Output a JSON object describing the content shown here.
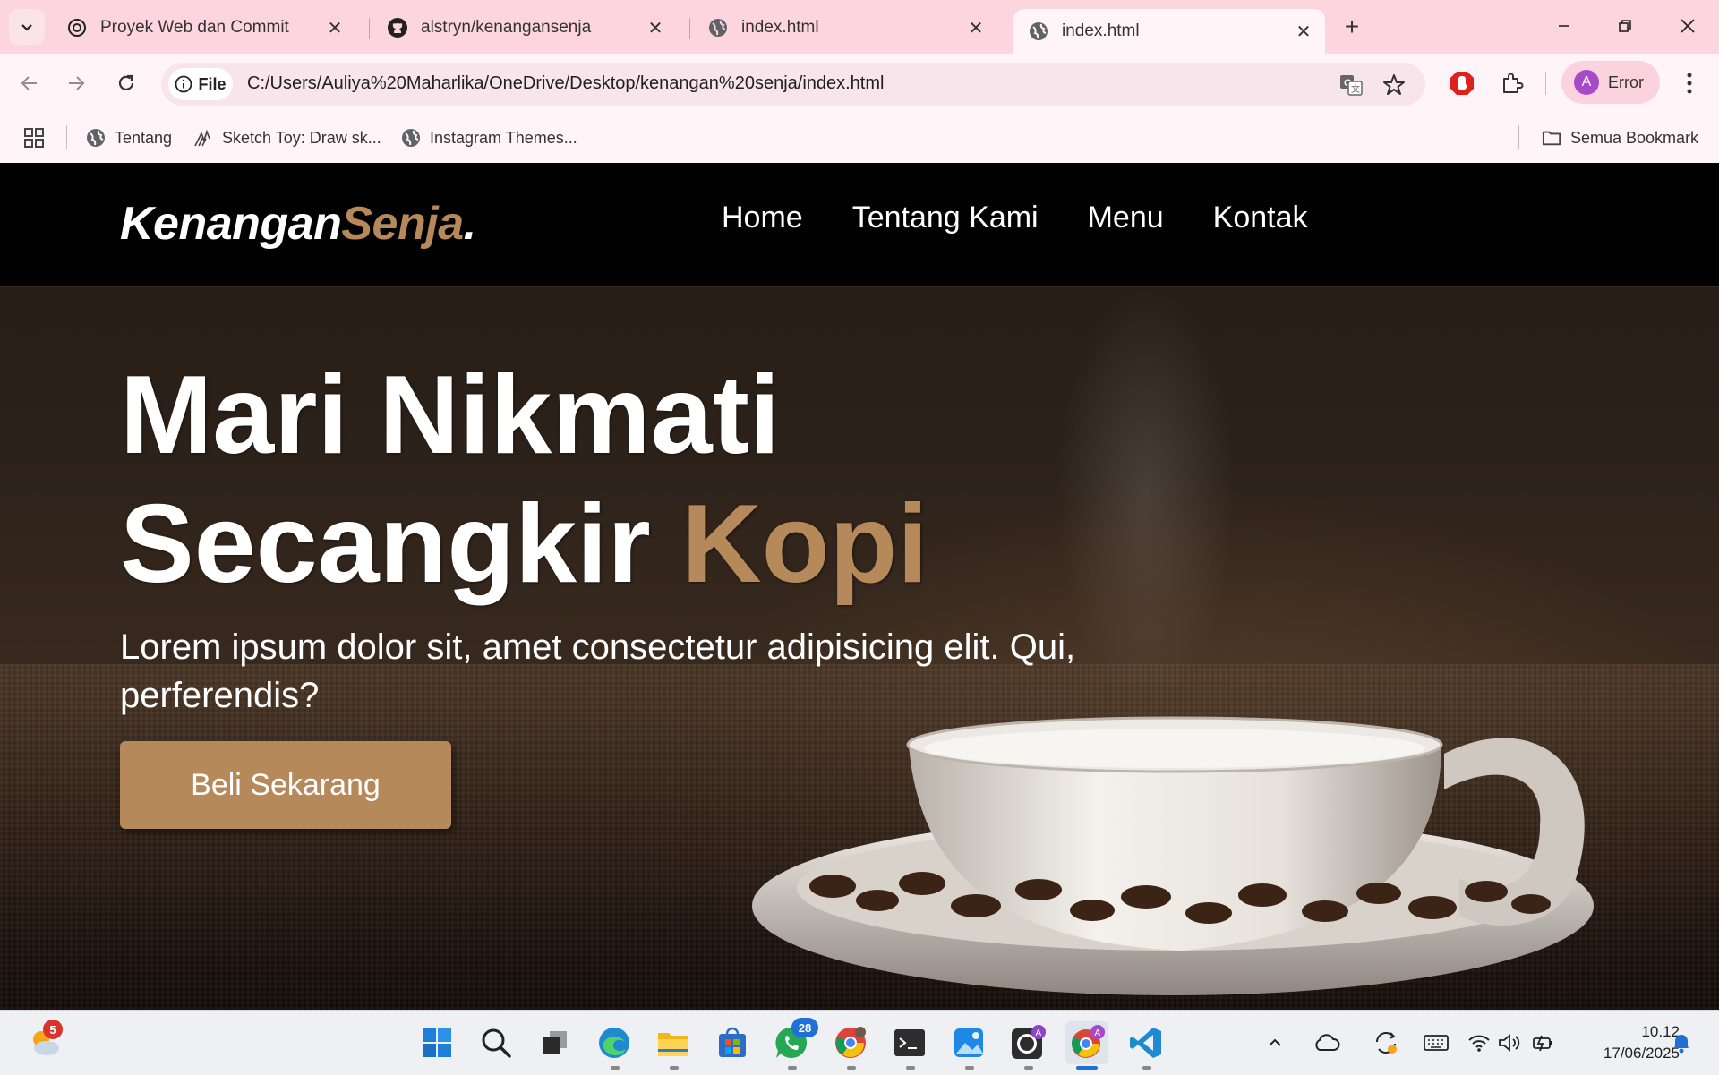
{
  "browser": {
    "tabs": [
      {
        "title": "Proyek Web dan Commit",
        "favicon": "openai-icon",
        "active": false
      },
      {
        "title": "alstryn/kenangansenja",
        "favicon": "github-icon",
        "active": false
      },
      {
        "title": "index.html",
        "favicon": "globe-icon",
        "active": false
      },
      {
        "title": "index.html",
        "favicon": "globe-icon",
        "active": true
      }
    ],
    "site_info_label": "File",
    "url": "C:/Users/Auliya%20Maharlika/OneDrive/Desktop/kenangan%20senja/index.html",
    "profile": {
      "initial": "A",
      "label": "Error"
    },
    "bookmarks": [
      {
        "label": "Tentang",
        "icon": "globe-icon"
      },
      {
        "label": "Sketch Toy: Draw sk...",
        "icon": "sketch-icon"
      },
      {
        "label": "Instagram Themes...",
        "icon": "globe-icon"
      }
    ],
    "all_bookmarks_label": "Semua Bookmark"
  },
  "site": {
    "logo_main": "Kenangan",
    "logo_accent": "Senja",
    "logo_dot": ".",
    "nav": [
      "Home",
      "Tentang Kami",
      "Menu",
      "Kontak"
    ],
    "hero": {
      "title_line1": "Mari Nikmati",
      "title_line2": "Secangkir",
      "title_accent": "Kopi",
      "description": "Lorem ipsum dolor sit, amet consectetur adipisicing elit. Qui, perferendis?",
      "cta": "Beli Sekarang"
    },
    "colors": {
      "accent": "#b6895b",
      "navbar": "#000000"
    }
  },
  "taskbar": {
    "weather_badge": "5",
    "whatsapp_badge": "28",
    "time": "10.12",
    "date": "17/06/2025",
    "apps": [
      "start-icon",
      "search-icon",
      "task-view-icon",
      "edge-icon",
      "file-explorer-icon",
      "store-icon",
      "whatsapp-icon",
      "chrome-icon",
      "terminal-icon",
      "photos-icon",
      "github-desktop-icon",
      "chrome-icon",
      "vscode-icon"
    ]
  }
}
